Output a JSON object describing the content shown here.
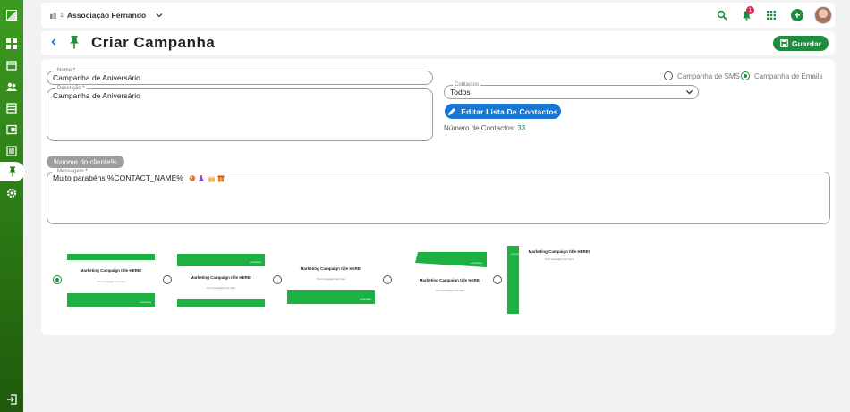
{
  "topbar": {
    "org_number": "1",
    "org_name": "Associação Fernando",
    "notification_count": "1"
  },
  "header": {
    "title": "Criar Campanha",
    "save_label": "Guardar"
  },
  "form": {
    "name_label": "Nome",
    "name_value": "Campanha de Aniversário",
    "description_label": "Descrição",
    "description_value": "Campanha de Aniversário",
    "channel_sms_label": "Campanha de SMS",
    "channel_email_label": "Campanha de Emails",
    "selected_channel": "email",
    "contacts_label": "Contactos",
    "contacts_value": "Todos",
    "edit_contacts_label": "Editar Lista De Contactos",
    "contacts_count_label": "Número de Contactos:",
    "contacts_count_value": "33",
    "placeholder_chip": "%nome do cliente%",
    "message_label": "Mensagem",
    "message_value": "Muito parabéns  %CONTACT_NAME%",
    "required_mark": "*"
  },
  "templates": [
    {
      "title": "Marketing Campaign title HERE!",
      "subtitle": "Your campaign text here",
      "logo": "● Company",
      "selected": true
    },
    {
      "title": "Marketing Campaign title HERE!",
      "subtitle": "Your campaign text here",
      "logo": "● Company",
      "selected": false
    },
    {
      "title": "Marketing Campaign title HERE!",
      "subtitle": "Your campaign text here",
      "logo": "● Company",
      "selected": false
    },
    {
      "title": "Marketing Campaign title HERE!",
      "subtitle": "Your campaign text here",
      "logo": "● Company",
      "selected": false
    },
    {
      "title": "Marketing Campaign title HERE!",
      "subtitle": "Your campaign text here",
      "logo": "● Company",
      "selected": false
    }
  ],
  "icons": {
    "sidebar": [
      "logo-icon",
      "dashboard-icon",
      "calendar-icon",
      "users-icon",
      "list-icon",
      "wallet-icon",
      "document-icon",
      "pin-icon",
      "settings-icon",
      "logout-icon"
    ],
    "topbar": [
      "search-icon",
      "bell-icon",
      "apps-grid-icon",
      "add-icon",
      "avatar"
    ]
  },
  "colors": {
    "brand_green": "#1e8e3e",
    "accent_blue": "#1976d2",
    "badge_red": "#e0245e"
  }
}
